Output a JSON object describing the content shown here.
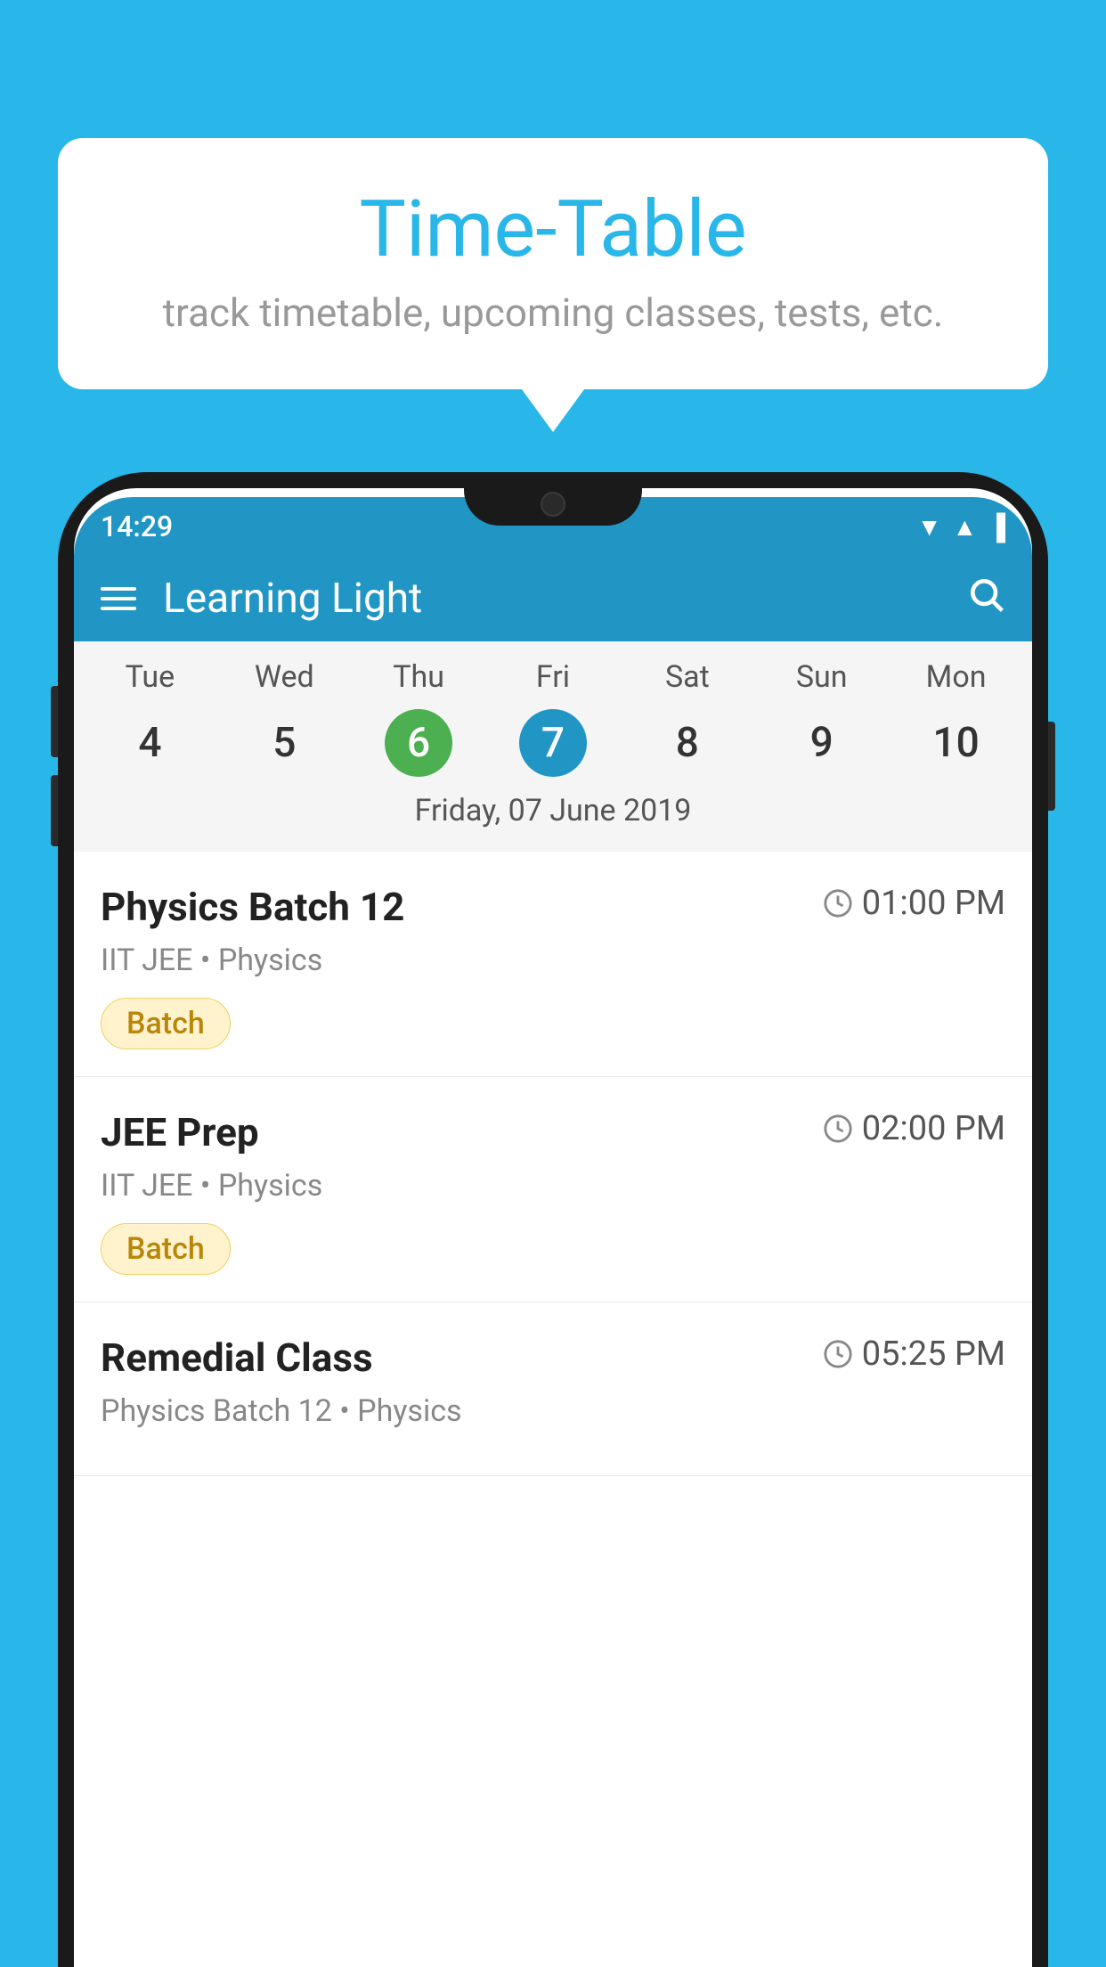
{
  "background": {
    "color": "#29b6e8"
  },
  "tooltip": {
    "title": "Time-Table",
    "subtitle": "track timetable, upcoming classes, tests, etc."
  },
  "phone": {
    "status_bar": {
      "time": "14:29"
    },
    "app_header": {
      "title": "Learning Light"
    },
    "calendar": {
      "days": [
        "Tue",
        "Wed",
        "Thu",
        "Fri",
        "Sat",
        "Sun",
        "Mon"
      ],
      "dates": [
        "4",
        "5",
        "6",
        "7",
        "8",
        "9",
        "10"
      ],
      "today_index": 2,
      "selected_index": 3,
      "selected_label": "Friday, 07 June 2019"
    },
    "schedule": [
      {
        "title": "Physics Batch 12",
        "time": "01:00 PM",
        "subtitle": "IIT JEE • Physics",
        "badge": "Batch"
      },
      {
        "title": "JEE Prep",
        "time": "02:00 PM",
        "subtitle": "IIT JEE • Physics",
        "badge": "Batch"
      },
      {
        "title": "Remedial Class",
        "time": "05:25 PM",
        "subtitle": "Physics Batch 12 • Physics",
        "badge": null
      }
    ]
  }
}
